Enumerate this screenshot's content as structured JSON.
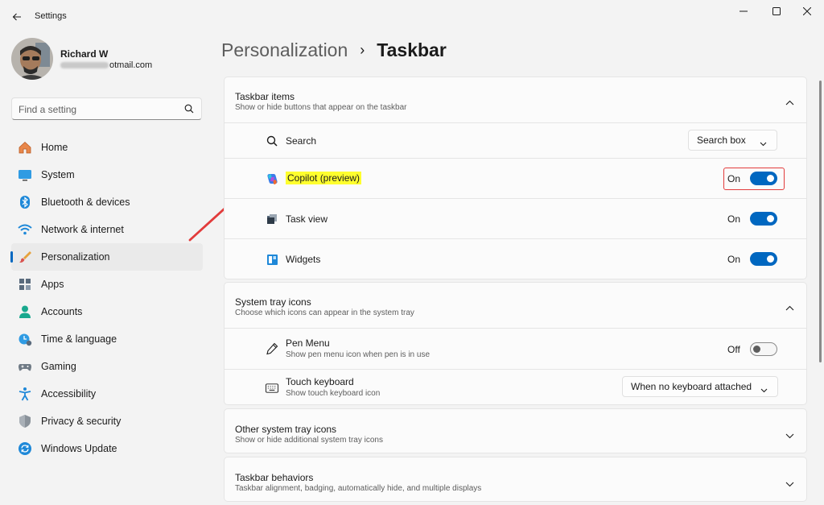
{
  "window": {
    "title": "Settings",
    "controls": {
      "minimize": "minimize",
      "maximize": "maximize",
      "close": "close"
    }
  },
  "profile": {
    "name": "Richard W",
    "email_visible": "otmail.com"
  },
  "search": {
    "placeholder": "Find a setting"
  },
  "sidebar": {
    "items": [
      {
        "label": "Home",
        "icon": "home-icon"
      },
      {
        "label": "System",
        "icon": "system-icon"
      },
      {
        "label": "Bluetooth & devices",
        "icon": "bluetooth-icon"
      },
      {
        "label": "Network & internet",
        "icon": "wifi-icon"
      },
      {
        "label": "Personalization",
        "icon": "brush-icon",
        "active": true
      },
      {
        "label": "Apps",
        "icon": "apps-icon"
      },
      {
        "label": "Accounts",
        "icon": "accounts-icon"
      },
      {
        "label": "Time & language",
        "icon": "time-language-icon"
      },
      {
        "label": "Gaming",
        "icon": "gaming-icon"
      },
      {
        "label": "Accessibility",
        "icon": "accessibility-icon"
      },
      {
        "label": "Privacy & security",
        "icon": "shield-icon"
      },
      {
        "label": "Windows Update",
        "icon": "update-icon"
      }
    ]
  },
  "breadcrumb": {
    "parent": "Personalization",
    "separator": "›",
    "current": "Taskbar"
  },
  "taskbar_items": {
    "title": "Taskbar items",
    "subtitle": "Show or hide buttons that appear on the taskbar",
    "search": {
      "label": "Search",
      "value": "Search box"
    },
    "copilot": {
      "label": "Copilot (preview)",
      "state": "On",
      "on": true
    },
    "task_view": {
      "label": "Task view",
      "state": "On",
      "on": true
    },
    "widgets": {
      "label": "Widgets",
      "state": "On",
      "on": true
    }
  },
  "system_tray": {
    "title": "System tray icons",
    "subtitle": "Choose which icons can appear in the system tray",
    "pen_menu": {
      "label": "Pen Menu",
      "sub": "Show pen menu icon when pen is in use",
      "state": "Off",
      "on": false
    },
    "touch_keyboard": {
      "label": "Touch keyboard",
      "sub": "Show touch keyboard icon",
      "value": "When no keyboard attached"
    }
  },
  "other_tray": {
    "title": "Other system tray icons",
    "subtitle": "Show or hide additional system tray icons"
  },
  "behaviors": {
    "title": "Taskbar behaviors",
    "subtitle": "Taskbar alignment, badging, automatically hide, and multiple displays"
  },
  "colors": {
    "accent": "#0067c0",
    "highlight": "#ffff2e",
    "annotation_red": "#e23b3b",
    "background": "#f3f3f3",
    "card": "#fbfbfb"
  }
}
